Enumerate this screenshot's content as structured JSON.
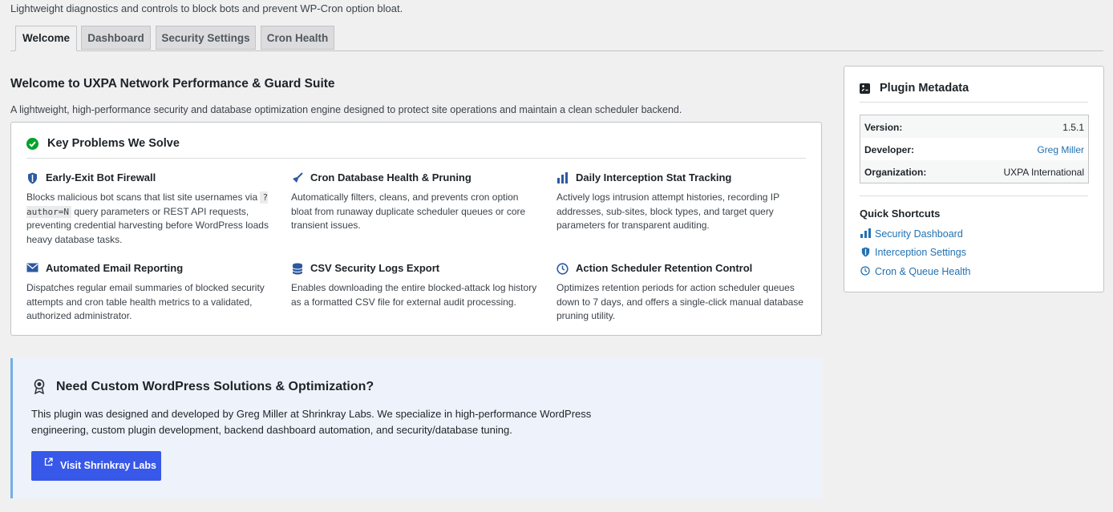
{
  "subtitle": "Lightweight diagnostics and controls to block bots and prevent WP-Cron option bloat.",
  "tabs": [
    "Welcome",
    "Dashboard",
    "Security Settings",
    "Cron Health"
  ],
  "active_tab": "Welcome",
  "main": {
    "title": "Welcome to UXPA Network Performance & Guard Suite",
    "description": "A lightweight, high-performance security and database optimization engine designed to protect site operations and maintain a clean scheduler backend."
  },
  "problems": {
    "heading": "Key Problems We Solve",
    "heading_icon": "check-circle-icon",
    "features": [
      {
        "icon": "shield-icon",
        "title": "Early-Exit Bot Firewall",
        "desc_pre": "Blocks malicious bot scans that list site usernames via ",
        "code": "?author=N",
        "desc_post": " query parameters or REST API requests, preventing credential harvesting before WordPress loads heavy database tasks."
      },
      {
        "icon": "broom-icon",
        "title": "Cron Database Health & Pruning",
        "desc": "Automatically filters, cleans, and prevents cron option bloat from runaway duplicate scheduler queues or core transient issues."
      },
      {
        "icon": "bar-chart-icon",
        "title": "Daily Interception Stat Tracking",
        "desc": "Actively logs intrusion attempt histories, recording IP addresses, sub-sites, block types, and target query parameters for transparent auditing."
      },
      {
        "icon": "email-icon",
        "title": "Automated Email Reporting",
        "desc": "Dispatches regular email summaries of blocked security attempts and cron table health metrics to a validated, authorized administrator."
      },
      {
        "icon": "database-icon",
        "title": "CSV Security Logs Export",
        "desc": "Enables downloading the entire blocked-attack log history as a formatted CSV file for external audit processing."
      },
      {
        "icon": "clock-icon",
        "title": "Action Scheduler Retention Control",
        "desc": "Optimizes retention periods for action scheduler queues down to 7 days, and offers a single-click manual database pruning utility."
      }
    ]
  },
  "promo": {
    "icon": "award-icon",
    "title": "Need Custom WordPress Solutions & Optimization?",
    "text": "This plugin was designed and developed by Greg Miller at Shrinkray Labs. We specialize in high-performance WordPress engineering, custom plugin development, backend dashboard automation, and security/database tuning.",
    "button_label": "Visit Shrinkray Labs"
  },
  "sidebar": {
    "title": "Plugin Metadata",
    "metadata": [
      {
        "key": "Version:",
        "value": "1.5.1",
        "link": false
      },
      {
        "key": "Developer:",
        "value": "Greg Miller",
        "link": true
      },
      {
        "key": "Organization:",
        "value": "UXPA International",
        "link": false
      }
    ],
    "shortcuts_title": "Quick Shortcuts",
    "shortcuts": [
      {
        "icon": "bar-chart-icon",
        "label": "Security Dashboard"
      },
      {
        "icon": "shield-icon",
        "label": "Interception Settings"
      },
      {
        "icon": "clock-icon",
        "label": "Cron & Queue Health"
      }
    ]
  },
  "colors": {
    "accent": "#3858e9",
    "link": "#2271b1",
    "success": "#00a32a",
    "promo_bg": "#eef2fa",
    "promo_border": "#72aee6"
  }
}
